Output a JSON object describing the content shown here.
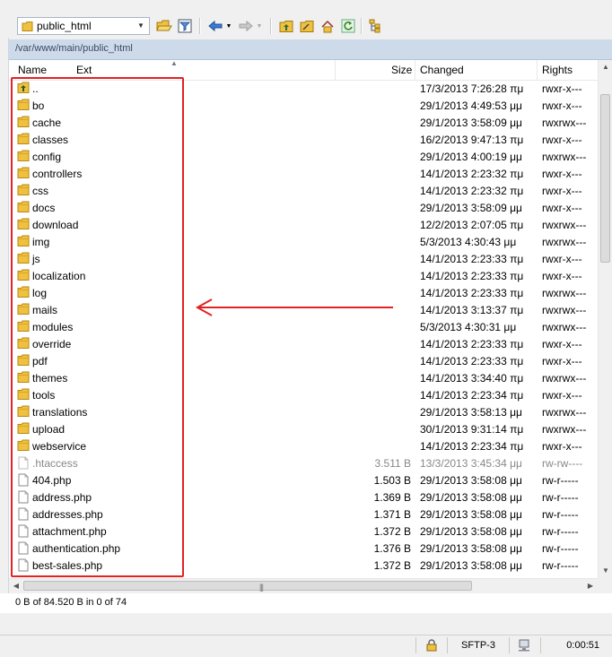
{
  "toolbar": {
    "location": "public_html"
  },
  "path_bar": "/var/www/main/public_html",
  "columns": {
    "name": "Name",
    "ext": "Ext",
    "size": "Size",
    "changed": "Changed",
    "rights": "Rights"
  },
  "files": [
    {
      "name": "..",
      "size": "",
      "changed": "17/3/2013 7:26:28 πμ",
      "rights": "rwxr-x---",
      "type": "parent"
    },
    {
      "name": "bo",
      "size": "",
      "changed": "29/1/2013 4:49:53 μμ",
      "rights": "rwxr-x---",
      "type": "folder"
    },
    {
      "name": "cache",
      "size": "",
      "changed": "29/1/2013 3:58:09 μμ",
      "rights": "rwxrwx---",
      "type": "folder"
    },
    {
      "name": "classes",
      "size": "",
      "changed": "16/2/2013 9:47:13 πμ",
      "rights": "rwxr-x---",
      "type": "folder"
    },
    {
      "name": "config",
      "size": "",
      "changed": "29/1/2013 4:00:19 μμ",
      "rights": "rwxrwx---",
      "type": "folder"
    },
    {
      "name": "controllers",
      "size": "",
      "changed": "14/1/2013 2:23:32 πμ",
      "rights": "rwxr-x---",
      "type": "folder"
    },
    {
      "name": "css",
      "size": "",
      "changed": "14/1/2013 2:23:32 πμ",
      "rights": "rwxr-x---",
      "type": "folder"
    },
    {
      "name": "docs",
      "size": "",
      "changed": "29/1/2013 3:58:09 μμ",
      "rights": "rwxr-x---",
      "type": "folder"
    },
    {
      "name": "download",
      "size": "",
      "changed": "12/2/2013 2:07:05 πμ",
      "rights": "rwxrwx---",
      "type": "folder"
    },
    {
      "name": "img",
      "size": "",
      "changed": "5/3/2013 4:30:43 μμ",
      "rights": "rwxrwx---",
      "type": "folder"
    },
    {
      "name": "js",
      "size": "",
      "changed": "14/1/2013 2:23:33 πμ",
      "rights": "rwxr-x---",
      "type": "folder"
    },
    {
      "name": "localization",
      "size": "",
      "changed": "14/1/2013 2:23:33 πμ",
      "rights": "rwxr-x---",
      "type": "folder"
    },
    {
      "name": "log",
      "size": "",
      "changed": "14/1/2013 2:23:33 πμ",
      "rights": "rwxrwx---",
      "type": "folder"
    },
    {
      "name": "mails",
      "size": "",
      "changed": "14/1/2013 3:13:37 πμ",
      "rights": "rwxrwx---",
      "type": "folder"
    },
    {
      "name": "modules",
      "size": "",
      "changed": "5/3/2013 4:30:31 μμ",
      "rights": "rwxrwx---",
      "type": "folder"
    },
    {
      "name": "override",
      "size": "",
      "changed": "14/1/2013 2:23:33 πμ",
      "rights": "rwxr-x---",
      "type": "folder"
    },
    {
      "name": "pdf",
      "size": "",
      "changed": "14/1/2013 2:23:33 πμ",
      "rights": "rwxr-x---",
      "type": "folder"
    },
    {
      "name": "themes",
      "size": "",
      "changed": "14/1/2013 3:34:40 πμ",
      "rights": "rwxrwx---",
      "type": "folder"
    },
    {
      "name": "tools",
      "size": "",
      "changed": "14/1/2013 2:23:34 πμ",
      "rights": "rwxr-x---",
      "type": "folder"
    },
    {
      "name": "translations",
      "size": "",
      "changed": "29/1/2013 3:58:13 μμ",
      "rights": "rwxrwx---",
      "type": "folder"
    },
    {
      "name": "upload",
      "size": "",
      "changed": "30/1/2013 9:31:14 πμ",
      "rights": "rwxrwx---",
      "type": "folder"
    },
    {
      "name": "webservice",
      "size": "",
      "changed": "14/1/2013 2:23:34 πμ",
      "rights": "rwxr-x---",
      "type": "folder"
    },
    {
      "name": ".htaccess",
      "size": "3.511 B",
      "changed": "13/3/2013 3:45:34 μμ",
      "rights": "rw-rw----",
      "type": "hidden"
    },
    {
      "name": "404.php",
      "size": "1.503 B",
      "changed": "29/1/2013 3:58:08 μμ",
      "rights": "rw-r-----",
      "type": "file"
    },
    {
      "name": "address.php",
      "size": "1.369 B",
      "changed": "29/1/2013 3:58:08 μμ",
      "rights": "rw-r-----",
      "type": "file"
    },
    {
      "name": "addresses.php",
      "size": "1.371 B",
      "changed": "29/1/2013 3:58:08 μμ",
      "rights": "rw-r-----",
      "type": "file"
    },
    {
      "name": "attachment.php",
      "size": "1.372 B",
      "changed": "29/1/2013 3:58:08 μμ",
      "rights": "rw-r-----",
      "type": "file"
    },
    {
      "name": "authentication.php",
      "size": "1.376 B",
      "changed": "29/1/2013 3:58:08 μμ",
      "rights": "rw-r-----",
      "type": "file"
    },
    {
      "name": "best-sales.php",
      "size": "1.372 B",
      "changed": "29/1/2013 3:58:08 μμ",
      "rights": "rw-r-----",
      "type": "file"
    }
  ],
  "selection_status": "0 B of 84.520 B in 0 of 74",
  "status_bar": {
    "protocol": "SFTP-3",
    "elapsed": "0:00:51"
  },
  "colors": {
    "annotation": "#e32222",
    "folder": "#f0c040",
    "path_bar": "#cddaea"
  },
  "icons": [
    "folder-icon",
    "parent-folder-icon",
    "file-icon",
    "filter-icon",
    "back-arrow-icon",
    "forward-arrow-icon",
    "parent-dir-icon",
    "root-dir-icon",
    "home-icon",
    "refresh-icon",
    "tree-icon",
    "lock-icon",
    "network-icon"
  ]
}
